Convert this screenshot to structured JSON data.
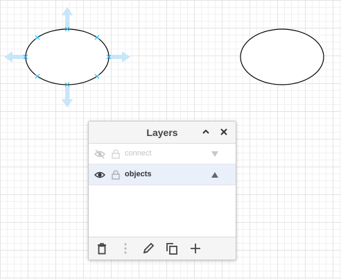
{
  "panel": {
    "title": "Layers",
    "layers": [
      {
        "name": "connect",
        "visible": false,
        "locked": false,
        "selected": false,
        "move_icon": "arrow-down-icon"
      },
      {
        "name": "objects",
        "visible": true,
        "locked": false,
        "selected": true,
        "move_icon": "arrow-up-icon"
      }
    ],
    "footer_icons": [
      "trash-icon",
      "more-vert-icon",
      "pencil-icon",
      "copy-icon",
      "plus-icon"
    ]
  },
  "canvas": {
    "shapes": [
      {
        "type": "ellipse",
        "selected": true
      },
      {
        "type": "ellipse",
        "selected": false
      }
    ]
  },
  "colors": {
    "selection_handle": "#29b6f2",
    "hover_arrow": "#c8e6f9",
    "stroke": "#000000",
    "grid": "#e3e3e3"
  }
}
